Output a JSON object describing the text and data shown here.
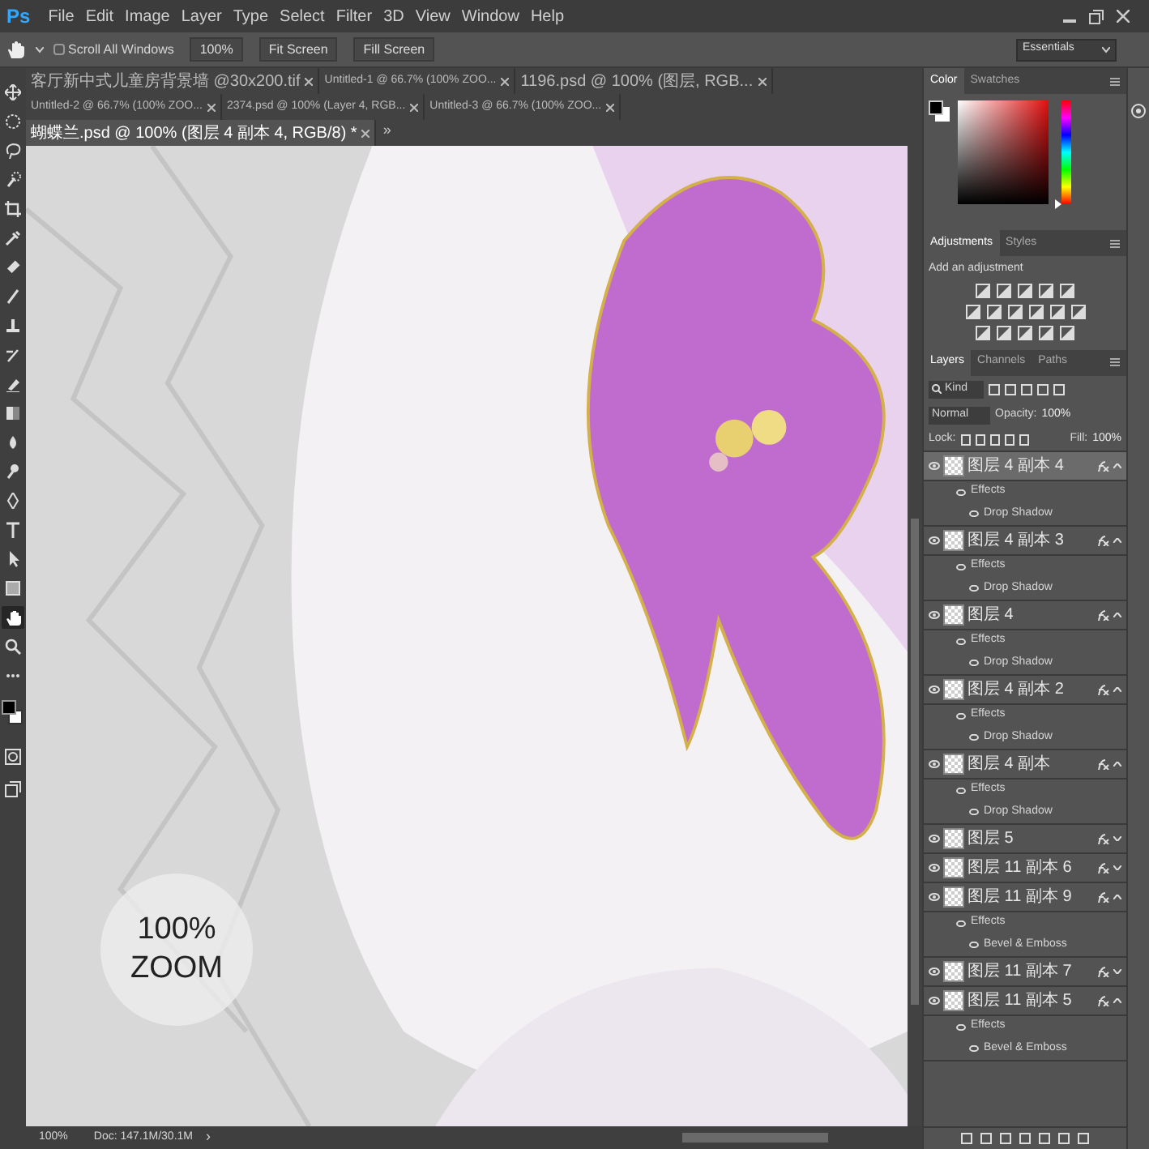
{
  "app": {
    "logo": "Ps",
    "menu": [
      "File",
      "Edit",
      "Image",
      "Layer",
      "Type",
      "Select",
      "Filter",
      "3D",
      "View",
      "Window",
      "Help"
    ]
  },
  "options_bar": {
    "scroll_all_windows": {
      "label": "Scroll All Windows",
      "checked": false
    },
    "buttons": [
      "100%",
      "Fit Screen",
      "Fill Screen"
    ],
    "workspace": "Essentials"
  },
  "document_tabs": [
    {
      "label": "客厅新中式儿童房背景墙 @30x200.tif",
      "selected": false
    },
    {
      "label": "Untitled-1 @ 66.7% (100% ZOO...",
      "selected": false
    },
    {
      "label": "1196.psd @ 100% (图层, RGB...",
      "selected": false
    },
    {
      "label": "Untitled-2 @ 66.7% (100% ZOO...",
      "selected": false
    },
    {
      "label": "2374.psd @ 100% (Layer 4, RGB...",
      "selected": false
    },
    {
      "label": "Untitled-3 @ 66.7% (100% ZOO...",
      "selected": false
    },
    {
      "label": "蝴蝶兰.psd @ 100% (图层 4 副本 4, RGB/8) *",
      "selected": true
    }
  ],
  "tabs_overflow": "»",
  "toolbar": {
    "tools": [
      {
        "selected": false
      },
      {
        "selected": false
      },
      {
        "selected": false
      },
      {
        "selected": false
      },
      {
        "selected": false
      },
      {
        "selected": false
      },
      {
        "selected": false
      },
      {
        "selected": false
      },
      {
        "selected": false
      },
      {
        "selected": false
      },
      {
        "selected": false
      },
      {
        "selected": false
      },
      {
        "selected": false
      },
      {
        "selected": false
      },
      {
        "selected": false
      },
      {
        "selected": false
      },
      {
        "selected": false
      },
      {
        "selected": false
      },
      {
        "selected": true
      },
      {
        "selected": false
      },
      {
        "selected": false
      }
    ]
  },
  "canvas": {
    "zoom_badge": [
      "100%",
      "ZOOM"
    ]
  },
  "color_panel": {
    "tabs": [
      {
        "label": "Color",
        "selected": true
      },
      {
        "label": "Swatches",
        "selected": false
      }
    ],
    "hue_slider": {
      "level": 0
    }
  },
  "adjustments_panel": {
    "tabs": [
      {
        "label": "Adjustments",
        "selected": true
      },
      {
        "label": "Styles",
        "selected": false
      }
    ],
    "hint": "Add an adjustment"
  },
  "layers_panel": {
    "tabs": [
      {
        "label": "Layers",
        "selected": true
      },
      {
        "label": "Channels",
        "selected": false
      },
      {
        "label": "Paths",
        "selected": false
      }
    ],
    "filter": "Kind",
    "blend_mode": "Normal",
    "opacity_label": "Opacity:",
    "opacity": "100%",
    "lock_label": "Lock:",
    "fill_label": "Fill:",
    "fill": "100%",
    "layers": [
      {
        "name": "图层 4 副本 4",
        "selected": true,
        "expanded": true,
        "effects_label": "Effects",
        "effects": [
          "Drop Shadow"
        ]
      },
      {
        "name": "图层 4 副本 3",
        "selected": false,
        "expanded": true,
        "effects_label": "Effects",
        "effects": [
          "Drop Shadow"
        ]
      },
      {
        "name": "图层 4",
        "selected": false,
        "expanded": true,
        "effects_label": "Effects",
        "effects": [
          "Drop Shadow"
        ]
      },
      {
        "name": "图层 4 副本 2",
        "selected": false,
        "expanded": true,
        "effects_label": "Effects",
        "effects": [
          "Drop Shadow"
        ]
      },
      {
        "name": "图层 4 副本",
        "selected": false,
        "expanded": true,
        "effects_label": "Effects",
        "effects": [
          "Drop Shadow"
        ]
      },
      {
        "name": "图层 5",
        "selected": false,
        "expanded": false
      },
      {
        "name": "图层 11 副本 6",
        "selected": false,
        "expanded": false
      },
      {
        "name": "图层 11 副本 9",
        "selected": false,
        "expanded": true,
        "effects_label": "Effects",
        "effects": [
          "Bevel & Emboss"
        ]
      },
      {
        "name": "图层 11 副本 7",
        "selected": false,
        "expanded": false
      },
      {
        "name": "图层 11 副本 5",
        "selected": false,
        "expanded": true,
        "effects_label": "Effects",
        "effects": [
          "Bevel & Emboss"
        ]
      }
    ]
  },
  "status_bar": {
    "zoom": "100%",
    "doc_size": "Doc: 147.1M/30.1M",
    "arrow": "›"
  }
}
